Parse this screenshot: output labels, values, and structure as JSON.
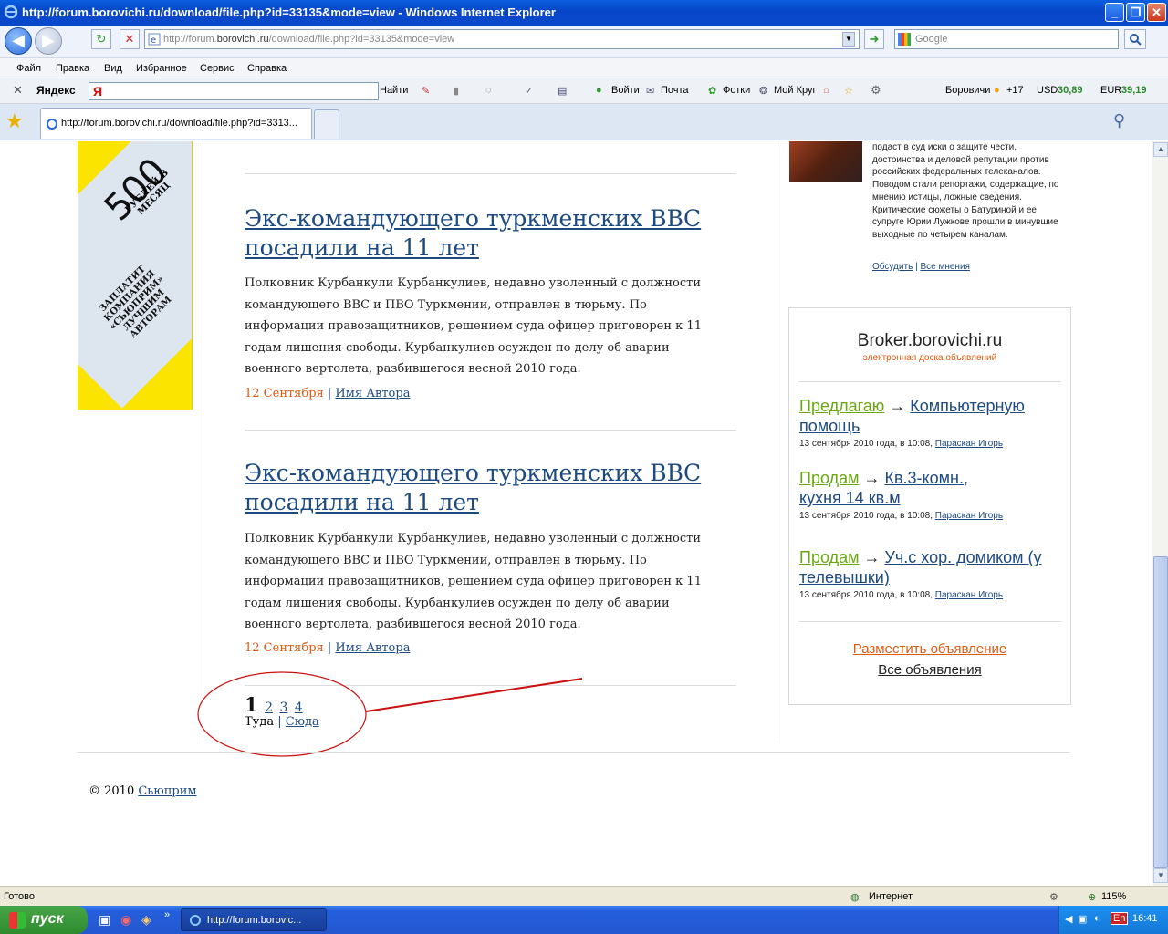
{
  "window": {
    "title": "http://forum.borovichi.ru/download/file.php?id=33135&mode=view - Windows Internet Explorer",
    "minimize": "_",
    "maximize": "❐",
    "close": "✕"
  },
  "nav": {
    "back": "◀",
    "forward": "▶",
    "refresh": "↻",
    "stop": "✕",
    "address_prefix": "http://forum.",
    "address_domain": "borovichi.ru",
    "address_rest": "/download/file.php?id=33135&mode=view",
    "go": "➜",
    "search_placeholder": "Google"
  },
  "menu": [
    "Файл",
    "Правка",
    "Вид",
    "Избранное",
    "Сервис",
    "Справка"
  ],
  "yandex": {
    "logo": "Яндекс",
    "input_value": "Я",
    "find": "Найти",
    "login": "Войти",
    "mail": "Почта",
    "photos": "Фотки",
    "circle": "Мой Круг",
    "city": "Боровичи",
    "temp": "+17",
    "usd_label": "USD",
    "usd": "30,89",
    "eur_label": "EUR",
    "eur": "39,19"
  },
  "tab": {
    "title": "http://forum.borovichi.ru/download/file.php?id=3313..."
  },
  "banner": {
    "number": "500",
    "line1": "РУБЛЕЙ В МЕСЯЦ",
    "line2": "ЗАПЛАТИТ КОМПАНИЯ «СЬЮПРИМ» ЛУЧШИМ АВТОРАМ"
  },
  "articles": [
    {
      "title": "Экс-командующего туркменских ВВС посадили на 11 лет",
      "body": "Полковник Курбанкули Курбанкулиев, недавно уволенный с должности командующего ВВС и ПВО Туркмении, отправлен в тюрьму. По информации правозащитников, решением суда офицер приговорен к 11 годам лишения свободы. Курбанкулиев осужден по делу об аварии военного вертолета, разбившегося весной 2010 года.",
      "date": "12 Сентября",
      "sep": "|",
      "author": "Имя Автора"
    },
    {
      "title": "Экс-командующего туркменских ВВС посадили на 11 лет",
      "body": "Полковник Курбанкули Курбанкулиев, недавно уволенный с должности командующего ВВС и ПВО Туркмении, отправлен в тюрьму. По информации правозащитников, решением суда офицер приговорен к 11 годам лишения свободы. Курбанкулиев осужден по делу об аварии военного вертолета, разбившегося весной 2010 года.",
      "date": "12 Сентября",
      "sep": "|",
      "author": "Имя Автора"
    }
  ],
  "pagination": {
    "current": "1",
    "pages": [
      "2",
      "3",
      "4"
    ],
    "prev": "Туда",
    "sep": "|",
    "next": "Сюда"
  },
  "footer": {
    "copyright": "© 2010",
    "brand": "Сьюприм"
  },
  "news": {
    "text": "подаст в суд иски о защите чести, достоинства и деловой репутации против российских федеральных телеканалов. Поводом стали репортажи, содержащие, по мнению истицы, ложные сведения. Критические сюжеты о Батуриной и ее супруге Юрии Лужкове прошли в минувшие выходные по четырем каналам.",
    "discuss": "Обсудить",
    "sep": "|",
    "all_opinions": "Все мнения"
  },
  "broker": {
    "title": "Broker.borovichi.ru",
    "subtitle": "электронная доска объявлений",
    "ads": [
      {
        "verb": "Предлагаю",
        "arrow": "→",
        "object": "Компьютерную помощь",
        "meta": "13 сентября 2010 года, в 10:08,",
        "author": "Параскан Игорь"
      },
      {
        "verb": "Продам",
        "arrow": "→",
        "object": "Кв.3-комн., кухня 14 кв.м",
        "meta": "13 сентября 2010 года, в 10:08,",
        "author": "Параскан Игорь"
      },
      {
        "verb": "Продам",
        "arrow": "→",
        "object": "Уч.с хор. домиком (у телевышки)",
        "meta": "13 сентября 2010 года, в 10:08,",
        "author": "Параскан Игорь"
      }
    ],
    "post": "Разместить объявление",
    "all": "Все объявления"
  },
  "statusbar": {
    "left": "Готово",
    "zone": "Интернет",
    "zoom": "115%"
  },
  "taskbar": {
    "start": "пуск",
    "item": "http://forum.borovic...",
    "lang": "En",
    "time": "16:41"
  },
  "colors": {
    "link": "#1d4a80",
    "date": "#e05a10",
    "verb": "#6aa812",
    "annotation": "#cc1111"
  }
}
